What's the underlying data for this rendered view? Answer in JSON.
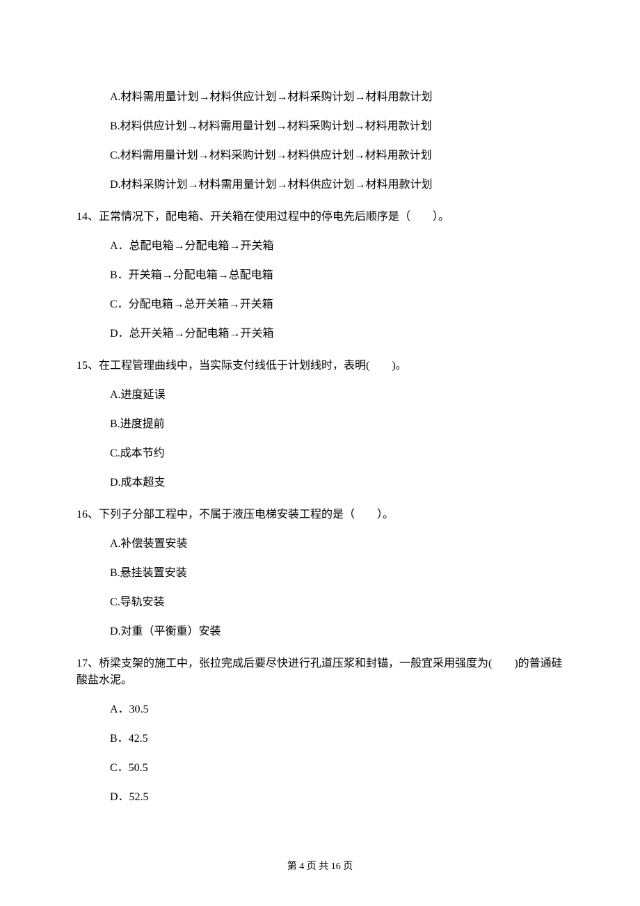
{
  "options_top": {
    "a": "A.材料需用量计划→材料供应计划→材料采购计划→材料用款计划",
    "b": "B.材料供应计划→材料需用量计划→材料采购计划→材料用款计划",
    "c": "C.材料需用量计划→材料采购计划→材料供应计划→材料用款计划",
    "d": "D.材料采购计划→材料需用量计划→材料供应计划→材料用款计划"
  },
  "q14": {
    "text": "14、正常情况下，配电箱、开关箱在使用过程中的停电先后顺序是（　　）。",
    "a": "A．总配电箱→分配电箱→开关箱",
    "b": "B．开关箱→分配电箱→总配电箱",
    "c": "C．分配电箱→总开关箱→开关箱",
    "d": "D．总开关箱→分配电箱→开关箱"
  },
  "q15": {
    "text": "15、在工程管理曲线中，当实际支付线低于计划线时，表明(　　)。",
    "a": "A.进度延误",
    "b": "B.进度提前",
    "c": "C.成本节约",
    "d": "D.成本超支"
  },
  "q16": {
    "text": "16、下列子分部工程中，不属于液压电梯安装工程的是（　　）。",
    "a": "A.补偿装置安装",
    "b": "B.悬挂装置安装",
    "c": "C.导轨安装",
    "d": "D.对重（平衡重）安装"
  },
  "q17": {
    "text": "17、桥梁支架的施工中，张拉完成后要尽快进行孔道压浆和封锚，一般宜采用强度为(　　)的普通硅酸盐水泥。",
    "a": "A．30.5",
    "b": "B．42.5",
    "c": "C．50.5",
    "d": "D．52.5"
  },
  "footer": "第 4 页 共 16 页"
}
